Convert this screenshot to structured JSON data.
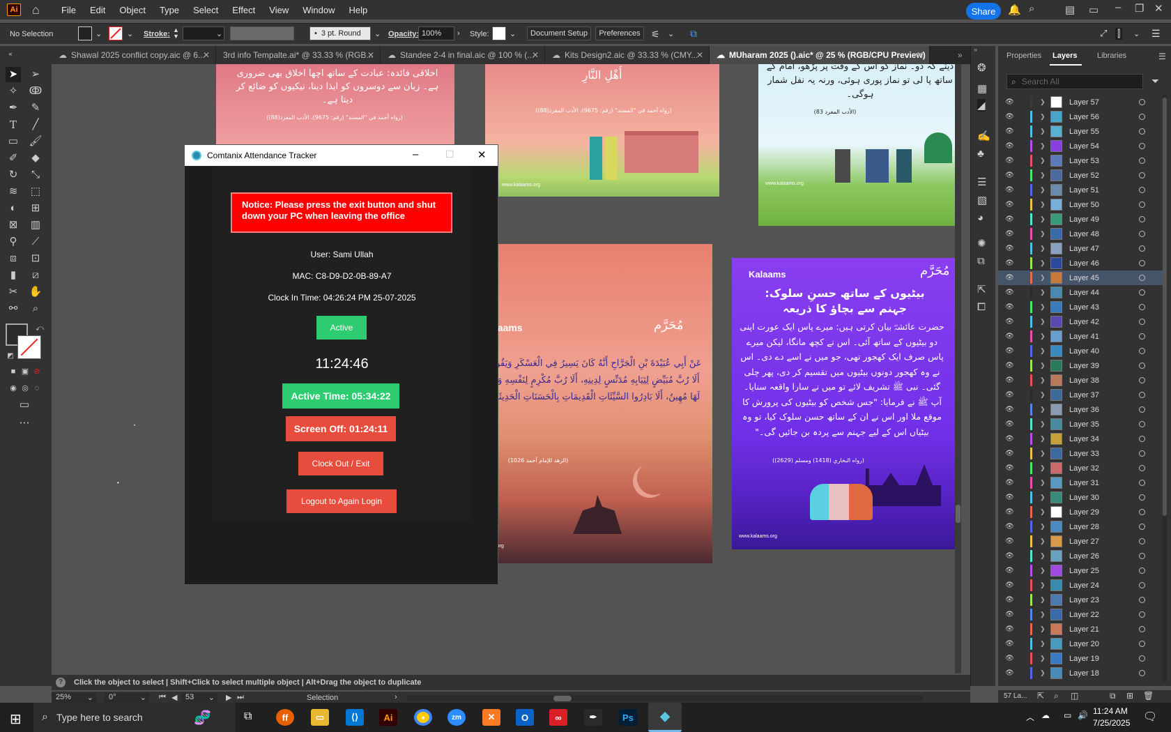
{
  "menubar": {
    "app_badge": "Ai",
    "items": [
      "File",
      "Edit",
      "Object",
      "Type",
      "Select",
      "Effect",
      "View",
      "Window",
      "Help"
    ],
    "share_label": "Share"
  },
  "control": {
    "selection": "No Selection",
    "stroke_label": "Stroke:",
    "brush": "3 pt. Round",
    "opacity_label": "Opacity:",
    "opacity_value": "100%",
    "style_label": "Style:",
    "document_setup": "Document Setup",
    "preferences": "Preferences"
  },
  "tabs": [
    {
      "label": "Shawal 2025 conflict copy.aic @ 6...",
      "active": false
    },
    {
      "label": "3rd info Tempalte.ai* @ 33.33 % (RGB...",
      "active": false
    },
    {
      "label": "Standee 2-4 in final.aic @ 100 % (...",
      "active": false
    },
    {
      "label": "Kits Design2.aic @ 33.33 % (CMY...",
      "active": false
    },
    {
      "label": "MUharam 2025 ().aic* @ 25 % (RGB/CPU Preview)",
      "active": true
    }
  ],
  "artboards": {
    "a1_text": "اخلاقی فائدہ: عبادت کے ساتھ اچھا اخلاق بھی ضروری ہے۔ زبان سے دوسروں کو ایذا دینا، نیکیوں کو ضائع کر دیتا ہے۔",
    "a1_ref": "(رواه أحمد في \"المسند\" (رقم: 9675)، الأدب المفرد(88))",
    "a2_text": "أَهْلِ النَّارِ",
    "a2_ref": "(رواه أحمد في \"المسند\" (رقم: 9675)، الأدب المفرد(88))",
    "a2_site": "www.kalaams.org",
    "a3_text": "دیتے کہ دو۔ نماز کو اس کے وقت پر پڑھو، امام کے ساتھ پا لی تو نماز پوری ہوئی، ورنہ یہ نفل شمار ہوگی۔",
    "a3_ref": "(الأدب المفرد 83)",
    "a3_site": "www.kalaams.org",
    "a4_brand": "Kalaams",
    "a4_title": "مُحَرَّم",
    "a4_arabic": "عَنْ أَبِي عُبَيْدَةَ بْنِ الْجَرَّاحِ أَنَّهُ كَانَ يَسِيرُ فِي الْعَسْكَرِ وَيَقُولُ: أَلَا رُبَّ مُبَيِّضٍ لِثِيَابِهِ مُدَنِّسٍ لِدِينِهِ، أَلَا رُبَّ مُكْرِمٍ لِنَفْسِهِ وَهُوَ لَهَا مُهِينٌ، أَلَا بَادِرُوا السَّيِّئَاتِ الْقَدِيمَاتِ بِالْحَسَنَاتِ الْحَدِيثَاتِ",
    "a4_ref": "(الزهد للإمام أحمد 1026)",
    "a4_site": "laams.org",
    "a5_brand": "Kalaams",
    "a5_title": "مُحَرَّم",
    "a5_heading": "بیٹیوں کے ساتھ حسنِ سلوک: جہنم سے بچاؤ کا ذریعہ",
    "a5_body": "حضرت عائشہؓ بیان کرتی ہیں: میرے پاس ایک عورت اپنی دو بیٹیوں کے ساتھ آئی۔ اس نے کچھ مانگا، لیکن میرے پاس صرف ایک کھجور تھی، جو میں نے اسے دے دی۔ اس نے وہ کھجور دونوں بیٹیوں میں تقسیم کر دی، پھر چلی گئی۔ نبی ﷺ تشریف لائے تو میں نے سارا واقعہ سنایا۔ آپ ﷺ نے فرمایا: \"جس شخص کو بیٹیوں کی پرورش کا موقع ملا اور اس نے ان کے ساتھ حسن سلوک کیا، تو وہ بیٹیاں اس کے لیے جہنم سے پردہ بن جائیں گی۔\"",
    "a5_ref": "(رواه البخاري (1418) ومسلم (2629))",
    "a5_site": "www.kalaams.org"
  },
  "tracker": {
    "title": "Comtanix Attendance Tracker",
    "notice": "Notice: Please press the exit button and shut down your PC when leaving the office",
    "user": "User: Sami Ullah",
    "mac": "MAC: C8-D9-D2-0B-89-A7",
    "clock_in": "Clock In Time: 04:26:24 PM 25-07-2025",
    "status": "Active",
    "clock": "11:24:46",
    "active_time": "Active Time: 05:34:22",
    "screen_off": "Screen Off: 01:24:11",
    "clock_out": "Clock Out / Exit",
    "logout": "Logout to Again Login"
  },
  "panel": {
    "tabs": [
      "Properties",
      "Layers",
      "Libraries"
    ],
    "search_placeholder": "Search All",
    "layer_count": "57 La...",
    "layers": [
      {
        "name": "Layer 57",
        "color": "#3a3a3a",
        "thumb": "#ffffff"
      },
      {
        "name": "Layer 56",
        "color": "#4fc1e9",
        "thumb": "#4aa3c9"
      },
      {
        "name": "Layer 55",
        "color": "#4fc1e9",
        "thumb": "#5ab0d0"
      },
      {
        "name": "Layer 54",
        "color": "#b64fe9",
        "thumb": "#8a3ee0"
      },
      {
        "name": "Layer 53",
        "color": "#e94f6a",
        "thumb": "#5a7ab8"
      },
      {
        "name": "Layer 52",
        "color": "#4fe96a",
        "thumb": "#4a6aa0"
      },
      {
        "name": "Layer 51",
        "color": "#4f6ae9",
        "thumb": "#6a8ab0"
      },
      {
        "name": "Layer 50",
        "color": "#e9c44f",
        "thumb": "#7ab0d8"
      },
      {
        "name": "Layer 49",
        "color": "#4fe9d5",
        "thumb": "#3a9a7a"
      },
      {
        "name": "Layer 48",
        "color": "#e94fb6",
        "thumb": "#3a6aa8"
      },
      {
        "name": "Layer 47",
        "color": "#4fc1e9",
        "thumb": "#8aa0c0"
      },
      {
        "name": "Layer 46",
        "color": "#9ae94f",
        "thumb": "#2a4a9a"
      },
      {
        "name": "Layer 45",
        "color": "#e96a4f",
        "thumb": "#c87a3a"
      },
      {
        "name": "Layer 44",
        "color": "#2a2a2a",
        "thumb": "#4a8ab0"
      },
      {
        "name": "Layer 43",
        "color": "#4fe96a",
        "thumb": "#3a7ab8"
      },
      {
        "name": "Layer 42",
        "color": "#4fc1e9",
        "thumb": "#5a4ab0"
      },
      {
        "name": "Layer 41",
        "color": "#e94fb6",
        "thumb": "#6aa0d0"
      },
      {
        "name": "Layer 40",
        "color": "#4f6ae9",
        "thumb": "#3a8ac0"
      },
      {
        "name": "Layer 39",
        "color": "#9ae94f",
        "thumb": "#2a7a5a"
      },
      {
        "name": "Layer 38",
        "color": "#e94f4f",
        "thumb": "#b87a5a"
      },
      {
        "name": "Layer 37",
        "color": "#2a2a2a",
        "thumb": "#3a6a9a"
      },
      {
        "name": "Layer 36",
        "color": "#4f8ae9",
        "thumb": "#8a9ab0"
      },
      {
        "name": "Layer 35",
        "color": "#4fe9d5",
        "thumb": "#4a8aa0"
      },
      {
        "name": "Layer 34",
        "color": "#b64fe9",
        "thumb": "#c8a03a"
      },
      {
        "name": "Layer 33",
        "color": "#e9c44f",
        "thumb": "#3a6aa0"
      },
      {
        "name": "Layer 32",
        "color": "#4fe96a",
        "thumb": "#c86a6a"
      },
      {
        "name": "Layer 31",
        "color": "#e94fb6",
        "thumb": "#5a9ac0"
      },
      {
        "name": "Layer 30",
        "color": "#4fc1e9",
        "thumb": "#3a8a7a"
      },
      {
        "name": "Layer 29",
        "color": "#e96a4f",
        "thumb": "#ffffff"
      },
      {
        "name": "Layer 28",
        "color": "#4f6ae9",
        "thumb": "#4a8ac0"
      },
      {
        "name": "Layer 27",
        "color": "#e9c44f",
        "thumb": "#d89a4a"
      },
      {
        "name": "Layer 26",
        "color": "#4fe9d5",
        "thumb": "#6aa0c0"
      },
      {
        "name": "Layer 25",
        "color": "#b64fe9",
        "thumb": "#a04ae0"
      },
      {
        "name": "Layer 24",
        "color": "#e94f4f",
        "thumb": "#3a8ab0"
      },
      {
        "name": "Layer 23",
        "color": "#9ae94f",
        "thumb": "#4a7ab0"
      },
      {
        "name": "Layer 22",
        "color": "#4f8ae9",
        "thumb": "#3a6aa8"
      },
      {
        "name": "Layer 21",
        "color": "#e96a4f",
        "thumb": "#c87a5a"
      },
      {
        "name": "Layer 20",
        "color": "#4fc1e9",
        "thumb": "#4a9ac0"
      },
      {
        "name": "Layer 19",
        "color": "#e94f4f",
        "thumb": "#3a7ac0"
      },
      {
        "name": "Layer 18",
        "color": "#4f6ae9",
        "thumb": "#4a8ab8"
      }
    ]
  },
  "hint": {
    "text": "Click the object to select  |  Shift+Click to select multiple object  |  Alt+Drag the object to duplicate"
  },
  "status": {
    "zoom": "25%",
    "rotation": "0°",
    "artboard": "53",
    "tool": "Selection"
  },
  "taskbar": {
    "search_placeholder": "Type here to search",
    "time": "11:24 AM",
    "date": "7/25/2025"
  }
}
